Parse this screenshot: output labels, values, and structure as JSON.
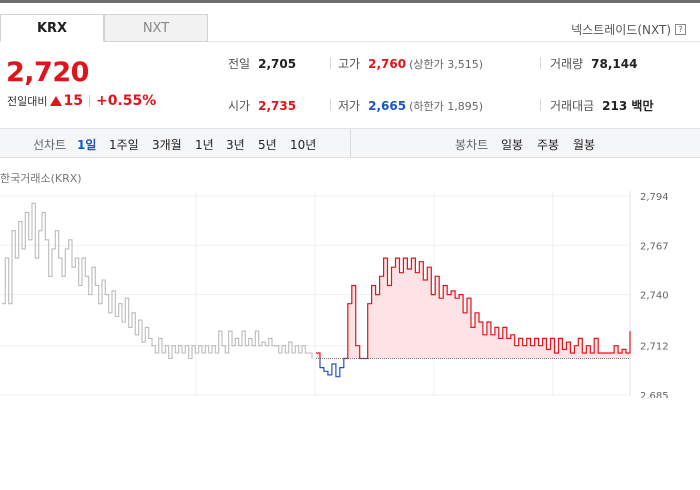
{
  "tabs": [
    {
      "label": "KRX",
      "active": true
    },
    {
      "label": "NXT",
      "active": false
    }
  ],
  "exchange_link": "넥스트레이드(NXT)",
  "help_icon": "?",
  "quote": {
    "price": "2,720",
    "change_label": "전일대비",
    "change_value": "15",
    "change_pct": "+0.55%",
    "direction": "up"
  },
  "stats": {
    "prev_close": {
      "label": "전일",
      "value": "2,705"
    },
    "high": {
      "label": "고가",
      "value": "2,760",
      "sub": "(상한가 3,515)"
    },
    "volume": {
      "label": "거래량",
      "value": "78,144"
    },
    "open": {
      "label": "시가",
      "value": "2,735"
    },
    "low": {
      "label": "저가",
      "value": "2,665",
      "sub": "(하한가 1,895)"
    },
    "amount": {
      "label": "거래대금",
      "value": "213 백만"
    }
  },
  "toolbar": {
    "line_label": "선차트",
    "periods": [
      "1일",
      "1주일",
      "3개월",
      "1년",
      "3년",
      "5년",
      "10년"
    ],
    "active_period": "1일",
    "candle_label": "봉차트",
    "candles": [
      "일봉",
      "주봉",
      "월봉"
    ]
  },
  "colors": {
    "up": "#e0141b",
    "down": "#1a54c9",
    "prev_day": "#bbbbbb"
  },
  "chart_data": {
    "type": "line",
    "title": "한국거래소(KRX)",
    "ylim": [
      2685,
      2794
    ],
    "yticks": [
      2685,
      2712,
      2740,
      2767,
      2794
    ],
    "ytick_labels": [
      "2,685",
      "2,712",
      "2,740",
      "2,767",
      "2,794"
    ],
    "baseline": 2705,
    "series": [
      {
        "values": [
          2735,
          2760,
          2735,
          2775,
          2760,
          2780,
          2765,
          2785,
          2770,
          2790,
          2760,
          2775,
          2785,
          2770,
          2750,
          2765,
          2775,
          2760,
          2750,
          2765,
          2770,
          2755,
          2760,
          2745,
          2760,
          2750,
          2740,
          2755,
          2745,
          2735,
          2748,
          2740,
          2730,
          2742,
          2728,
          2735,
          2725,
          2738,
          2722,
          2730,
          2718,
          2726,
          2714,
          2722,
          2716,
          2712,
          2708,
          2716,
          2708,
          2712,
          2705,
          2712,
          2708,
          2712,
          2708,
          2712,
          2705,
          2712,
          2708,
          2712,
          2708,
          2712,
          2708,
          2712,
          2708,
          2720,
          2712,
          2708,
          2720,
          2712,
          2716,
          2712,
          2720,
          2712,
          2716,
          2712,
          2720,
          2712,
          2714,
          2712,
          2716,
          2712,
          2712,
          2708,
          2712,
          2708,
          2714,
          2708,
          2712,
          2708,
          2712,
          2708,
          2708,
          2705
        ]
      },
      {
        "values": [
          2708,
          2700,
          2698,
          2696,
          2702,
          2695,
          2700,
          2705,
          2735,
          2745,
          2712,
          2705,
          2705,
          2735,
          2745,
          2740,
          2750,
          2760,
          2745,
          2755,
          2760,
          2752,
          2760,
          2754,
          2760,
          2752,
          2758,
          2748,
          2755,
          2740,
          2750,
          2738,
          2745,
          2740,
          2742,
          2738,
          2740,
          2730,
          2738,
          2722,
          2730,
          2725,
          2718,
          2725,
          2718,
          2722,
          2716,
          2722,
          2716,
          2718,
          2712,
          2716,
          2712,
          2716,
          2712,
          2716,
          2712,
          2716,
          2710,
          2716,
          2708,
          2716,
          2710,
          2714,
          2708,
          2712,
          2716,
          2708,
          2712,
          2708,
          2716,
          2708,
          2708,
          2708,
          2708,
          2712,
          2708,
          2710,
          2708,
          2720
        ]
      }
    ]
  }
}
